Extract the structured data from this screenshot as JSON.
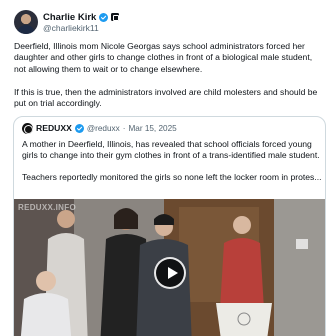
{
  "author": {
    "name": "Charlie Kirk",
    "handle": "@charliekirk11",
    "verified_icon": "verified-badge-icon",
    "affiliation_icon": "affiliation-badge-icon"
  },
  "post": {
    "paragraphs": [
      "Deerfield, Illinois mom Nicole Georgas says school administrators forced her daughter and other girls to change clothes in front of a biological male student, not allowing them to wait or to change elsewhere.",
      "If this is true, then the administrators involved are child molesters and should be put on trial accordingly."
    ]
  },
  "quote": {
    "name": "REDUXX",
    "handle": "@reduxx",
    "separator": "·",
    "date": "Mar 15, 2025",
    "paragraphs": [
      "A mother in Deerfield, Illinois, has revealed that school officials forced young girls to change into their gym clothes in front of a trans-identified male student.",
      "Teachers reportedly monitored the girls so none left the locker room in protes..."
    ],
    "media": {
      "watermark": "REDUXX.INFO",
      "play_icon": "play-icon",
      "colors": {
        "wall": "#8a8580",
        "wood": "#6b4a2f",
        "podium": "#ecebe6"
      }
    }
  }
}
